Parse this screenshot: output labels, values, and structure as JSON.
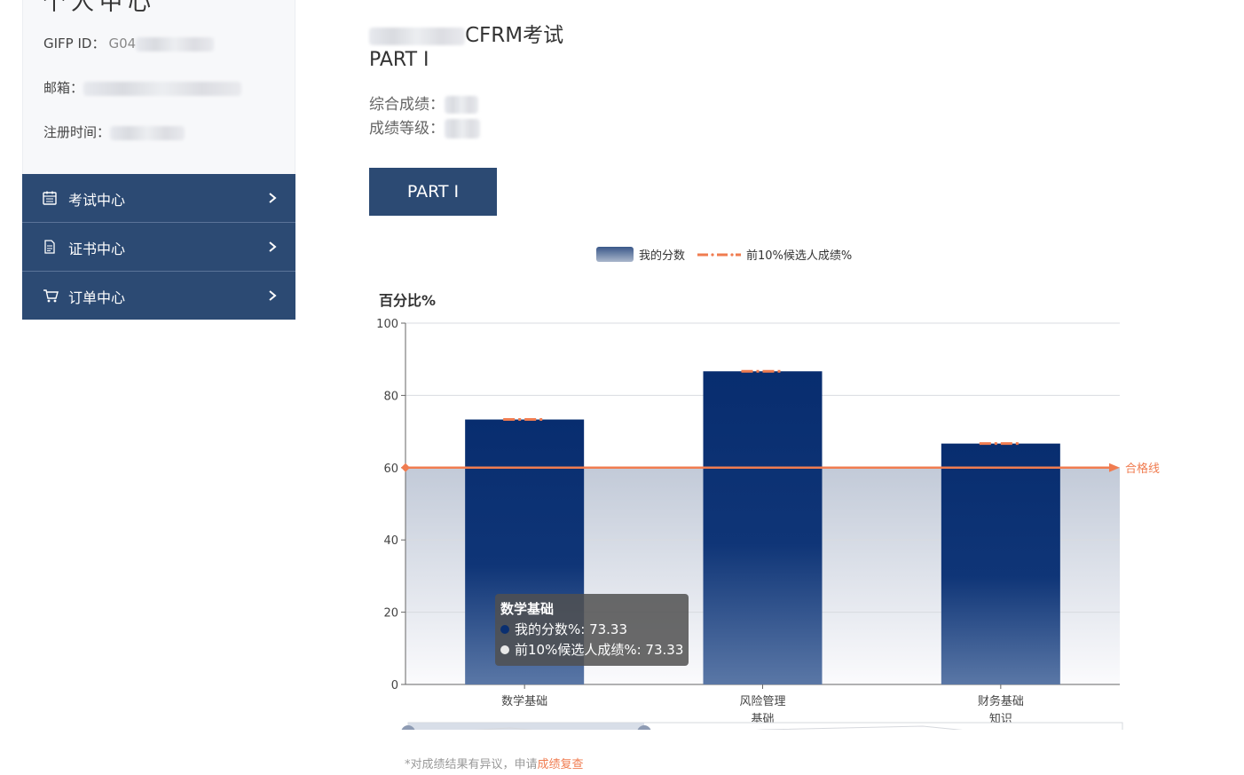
{
  "sidebar": {
    "title": "个人中心",
    "info": [
      {
        "label": "GIFP ID：",
        "value": "G04"
      },
      {
        "label": "邮箱：",
        "value": ""
      },
      {
        "label": "注册时间：",
        "value": ""
      }
    ],
    "menu": [
      {
        "label": "考试中心",
        "icon": "calendar-icon"
      },
      {
        "label": "证书中心",
        "icon": "document-icon"
      },
      {
        "label": "订单中心",
        "icon": "cart-icon"
      }
    ]
  },
  "main": {
    "exam_title": "CFRM考试",
    "part_title": "PART I",
    "overall_label": "综合成绩：",
    "grade_label": "成绩等级：",
    "part_button": "PART I",
    "footer_prefix": "*对成绩结果有异议，申请",
    "footer_link": "成绩复查"
  },
  "colors": {
    "nav": "#2c4a73",
    "bar": "#0a2f70",
    "pass_line": "#f07c50",
    "link": "#f07c50"
  },
  "chart_data": {
    "type": "bar",
    "ylabel": "百分比%",
    "ylim": [
      0,
      100
    ],
    "yticks": [
      0,
      20,
      40,
      60,
      80,
      100
    ],
    "categories": [
      "数学基础",
      "风险管理\n基础",
      "财务基础\n知识"
    ],
    "series": [
      {
        "name": "我的分数",
        "type": "bar",
        "values": [
          73.33,
          86.67,
          66.67
        ]
      },
      {
        "name": "前10%候选人成绩%",
        "type": "dash-mark",
        "values": [
          73.33,
          86.67,
          66.67
        ]
      }
    ],
    "pass_line": {
      "value": 60,
      "label": "合格线"
    },
    "legend": [
      "我的分数",
      "前10%候选人成绩%"
    ],
    "legend_position": "top-center",
    "grid": true,
    "tooltip": {
      "title": "数学基础",
      "rows": [
        "我的分数%: 73.33",
        "前10%候选人成绩%: 73.33"
      ]
    }
  }
}
